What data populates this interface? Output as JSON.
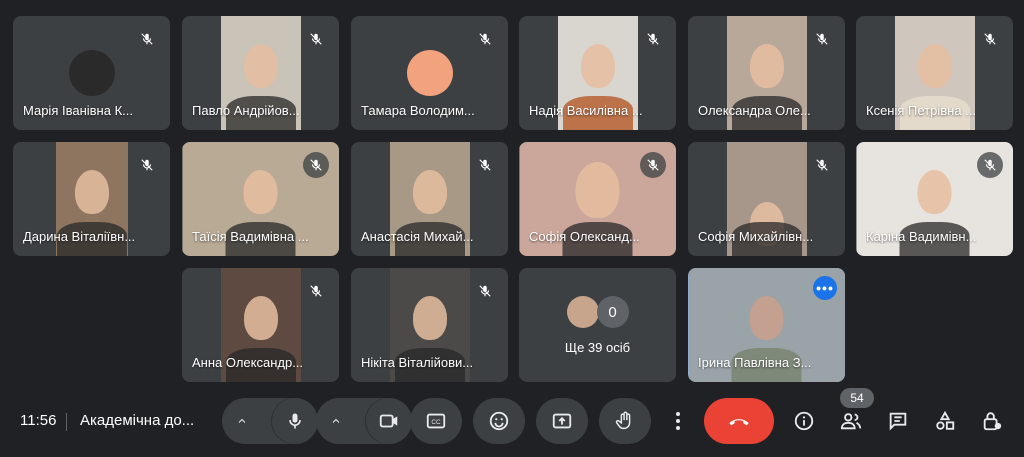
{
  "participants": [
    {
      "name": "Марія Іванівна К...",
      "kind": "avatar",
      "color": "#2a2a2a"
    },
    {
      "name": "Павло Андрійов...",
      "kind": "video",
      "color": "#c9c3b8"
    },
    {
      "name": "Тамара Володим...",
      "kind": "avatar",
      "color": "#f2a27c"
    },
    {
      "name": "Надія Василівна ...",
      "kind": "video",
      "color": "#d9d6cf"
    },
    {
      "name": "Олександра Оле...",
      "kind": "video",
      "color": "#b8a89a"
    },
    {
      "name": "Ксенія Петрівна ...",
      "kind": "video",
      "color": "#cfc7bd"
    },
    {
      "name": "Дарина Віталіївн...",
      "kind": "video",
      "color": "#8d7560"
    },
    {
      "name": "Таїсія Вадимівна ...",
      "kind": "video-wide",
      "color": "#b9aa96"
    },
    {
      "name": "Анастасія Михай...",
      "kind": "video",
      "color": "#a89886"
    },
    {
      "name": "Софія Олександ...",
      "kind": "video-wide",
      "color": "#caa69b"
    },
    {
      "name": "Софія Михайлівн...",
      "kind": "video",
      "color": "#a7978a"
    },
    {
      "name": "Каріна Вадимівн...",
      "kind": "video-wide",
      "color": "#e7e3df"
    },
    {
      "name": "Анна Олександр...",
      "kind": "video",
      "color": "#5e4a40"
    },
    {
      "name": "Нікіта Віталійови...",
      "kind": "video",
      "color": "#4c4a48"
    }
  ],
  "others": {
    "count": "0",
    "label": "Ще 39 осіб"
  },
  "presenter": {
    "name": "Ірина Павлівна З...",
    "color": "#9aa3a8"
  },
  "bottom_bar": {
    "time": "11:56",
    "meeting_title": "Академічна до...",
    "participants_count": "54",
    "buttons": [
      "mic-button",
      "camera-button",
      "captions-button",
      "emoji-button",
      "present-button",
      "raise-hand-button",
      "more-options-button",
      "leave-call-button",
      "info-button",
      "people-button",
      "chat-button",
      "activities-button",
      "host-controls-button"
    ]
  },
  "colors": {
    "background": "#202124",
    "tile": "#3c4043",
    "hangup": "#ea4335",
    "accent": "#8ab4f8"
  }
}
